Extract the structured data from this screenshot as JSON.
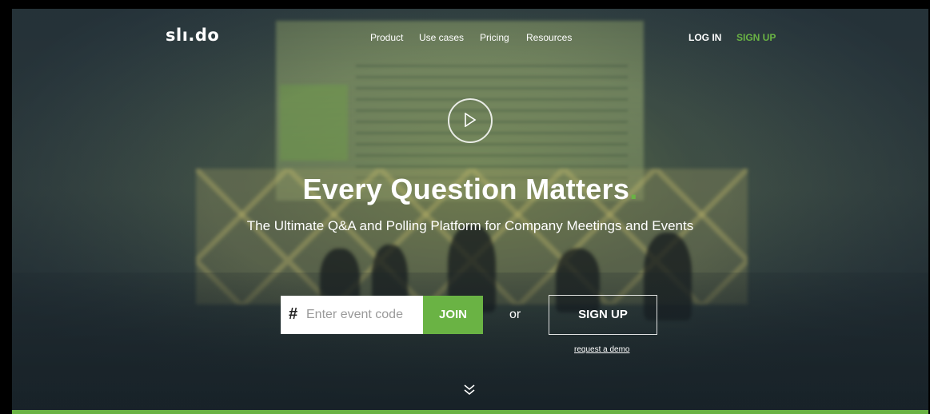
{
  "brand": {
    "logo_text": "slı.do",
    "accent_color": "#6ab344"
  },
  "nav": {
    "items": [
      {
        "label": "Product"
      },
      {
        "label": "Use cases"
      },
      {
        "label": "Pricing"
      },
      {
        "label": "Resources"
      }
    ],
    "login_label": "LOG IN",
    "signup_label": "SIGN UP"
  },
  "hero": {
    "play_icon": "play-icon",
    "headline": "Every Question Matters",
    "headline_dot": ".",
    "subheadline": "The Ultimate Q&A and Polling Platform for Company Meetings and Events"
  },
  "join_form": {
    "hash_symbol": "#",
    "placeholder": "Enter event code",
    "value": "",
    "join_label": "JOIN",
    "or_label": "or",
    "signup_label": "SIGN UP",
    "demo_link": "request a demo"
  },
  "scroll": {
    "icon": "double-chevron-down-icon"
  }
}
